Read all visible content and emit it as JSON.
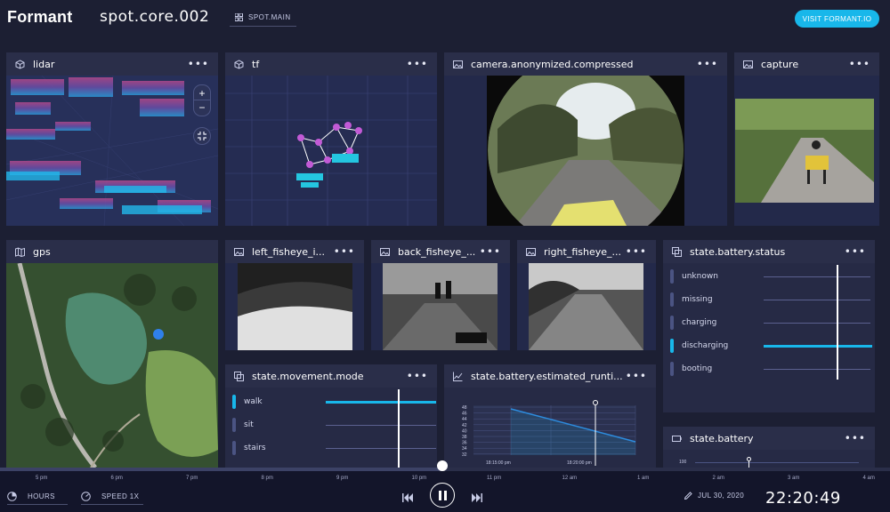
{
  "header": {
    "logo": "Formant",
    "device": "spot.core.002",
    "layout_chip": "SPOT.MAIN",
    "visit_button": "VISIT FORMANT.IO"
  },
  "panels": {
    "lidar": {
      "title": "lidar",
      "icon": "cube-icon"
    },
    "tf": {
      "title": "tf",
      "icon": "cube-icon"
    },
    "camera": {
      "title": "camera.anonymized.compressed",
      "icon": "image-icon"
    },
    "capture": {
      "title": "capture",
      "icon": "image-icon"
    },
    "gps": {
      "title": "gps",
      "icon": "map-icon"
    },
    "left_fisheye": {
      "title": "left_fisheye_i..."
    },
    "back_fisheye": {
      "title": "back_fisheye_..."
    },
    "right_fisheye": {
      "title": "right_fisheye_..."
    },
    "battery_status": {
      "title": "state.battery.status",
      "rows": [
        "unknown",
        "missing",
        "charging",
        "discharging",
        "booting"
      ],
      "active_index": 3
    },
    "movement_mode": {
      "title": "state.movement.mode",
      "rows": [
        "walk",
        "sit",
        "stairs"
      ],
      "active_index": 0
    },
    "runtime": {
      "title": "state.battery.estimated_runti...",
      "yticks": [
        "48",
        "46",
        "44",
        "42",
        "40",
        "38",
        "36",
        "34",
        "32"
      ],
      "xticks": [
        "18:15:00 pm",
        "18:20:00 pm"
      ]
    },
    "battery": {
      "title": "state.battery",
      "ytick": "100"
    }
  },
  "map_controls": {
    "zoom_in": "+",
    "zoom_out": "−"
  },
  "timeline": {
    "ticks": [
      "5 pm",
      "6 pm",
      "7 pm",
      "8 pm",
      "9 pm",
      "10 pm",
      "11 pm",
      "12 am",
      "1 am",
      "2 am",
      "3 am",
      "4 am"
    ],
    "hours_label": "HOURS",
    "speed_label": "SPEED 1X",
    "date": "JUL 30, 2020",
    "time": "22:20:49"
  },
  "colors": {
    "accent": "#18b7ea",
    "panel": "#2a2e49",
    "background": "#1c1f33"
  }
}
